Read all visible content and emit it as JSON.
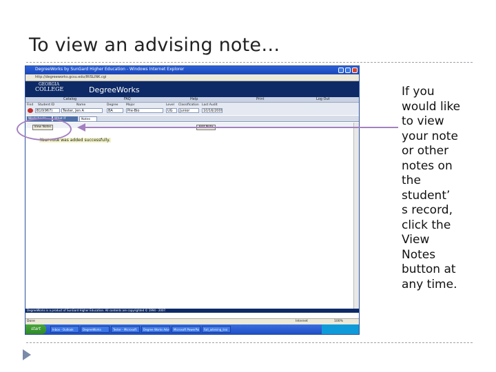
{
  "slide": {
    "title": "To view an advising note…",
    "caption_lines": [
      "If you",
      "would like",
      "to view",
      "your note",
      "or other",
      "notes on",
      "the",
      "student’",
      "s record,",
      "click the",
      "View",
      "Notes",
      "button at",
      "any time."
    ]
  },
  "colors": {
    "accent_purple": "#a480c0",
    "banner_navy": "#0d2a66",
    "title_bar_blue": "#2d62d6"
  },
  "screenshot": {
    "window_title": "DegreeWorks by SunGard Higher Education - Windows Internet Explorer",
    "address": "http://degreeworks.gcsu.edu/IRISLINK.cgi",
    "logo": {
      "line1": "GEORGIA",
      "line2": "COLLEGE"
    },
    "product": "DegreeWorks",
    "nav": [
      "Catalog",
      "FAQ",
      "Help",
      "Print",
      "Log Out"
    ],
    "fields": {
      "find_label": "Find",
      "student_id_label": "Student ID",
      "student_id": "B10(967)",
      "name_label": "Name",
      "name": "Tester, Jen A",
      "degree_label": "Degree",
      "degree": "BA",
      "major_label": "Major",
      "major": "Pre-Bio",
      "level_label": "Level",
      "level": "UG",
      "classification_label": "Classification",
      "classification": "Junior",
      "last_audit_label": "Last Audit",
      "last_audit": "10/16/2009"
    },
    "tabs": [
      "Worksheets",
      "What If",
      "Notes"
    ],
    "view_notes_button": "View Notes",
    "add_note_button": "Add Note",
    "message": "Your note was added successfully.",
    "footer_text": "DegreeWorks is a product of SunGard Higher Education. All contents are copyrighted © 1994 - 2007.",
    "status_left": "Done",
    "status_zone": "Internet",
    "status_zoom": "100%",
    "start_label": "start",
    "taskbar_items": [
      "Inbox - Outlook",
      "DegreeWorks",
      "Tester - Microsoft",
      "Degree Works Advi",
      "Microsoft PowerPoi",
      "Fall_advising_trai"
    ]
  }
}
